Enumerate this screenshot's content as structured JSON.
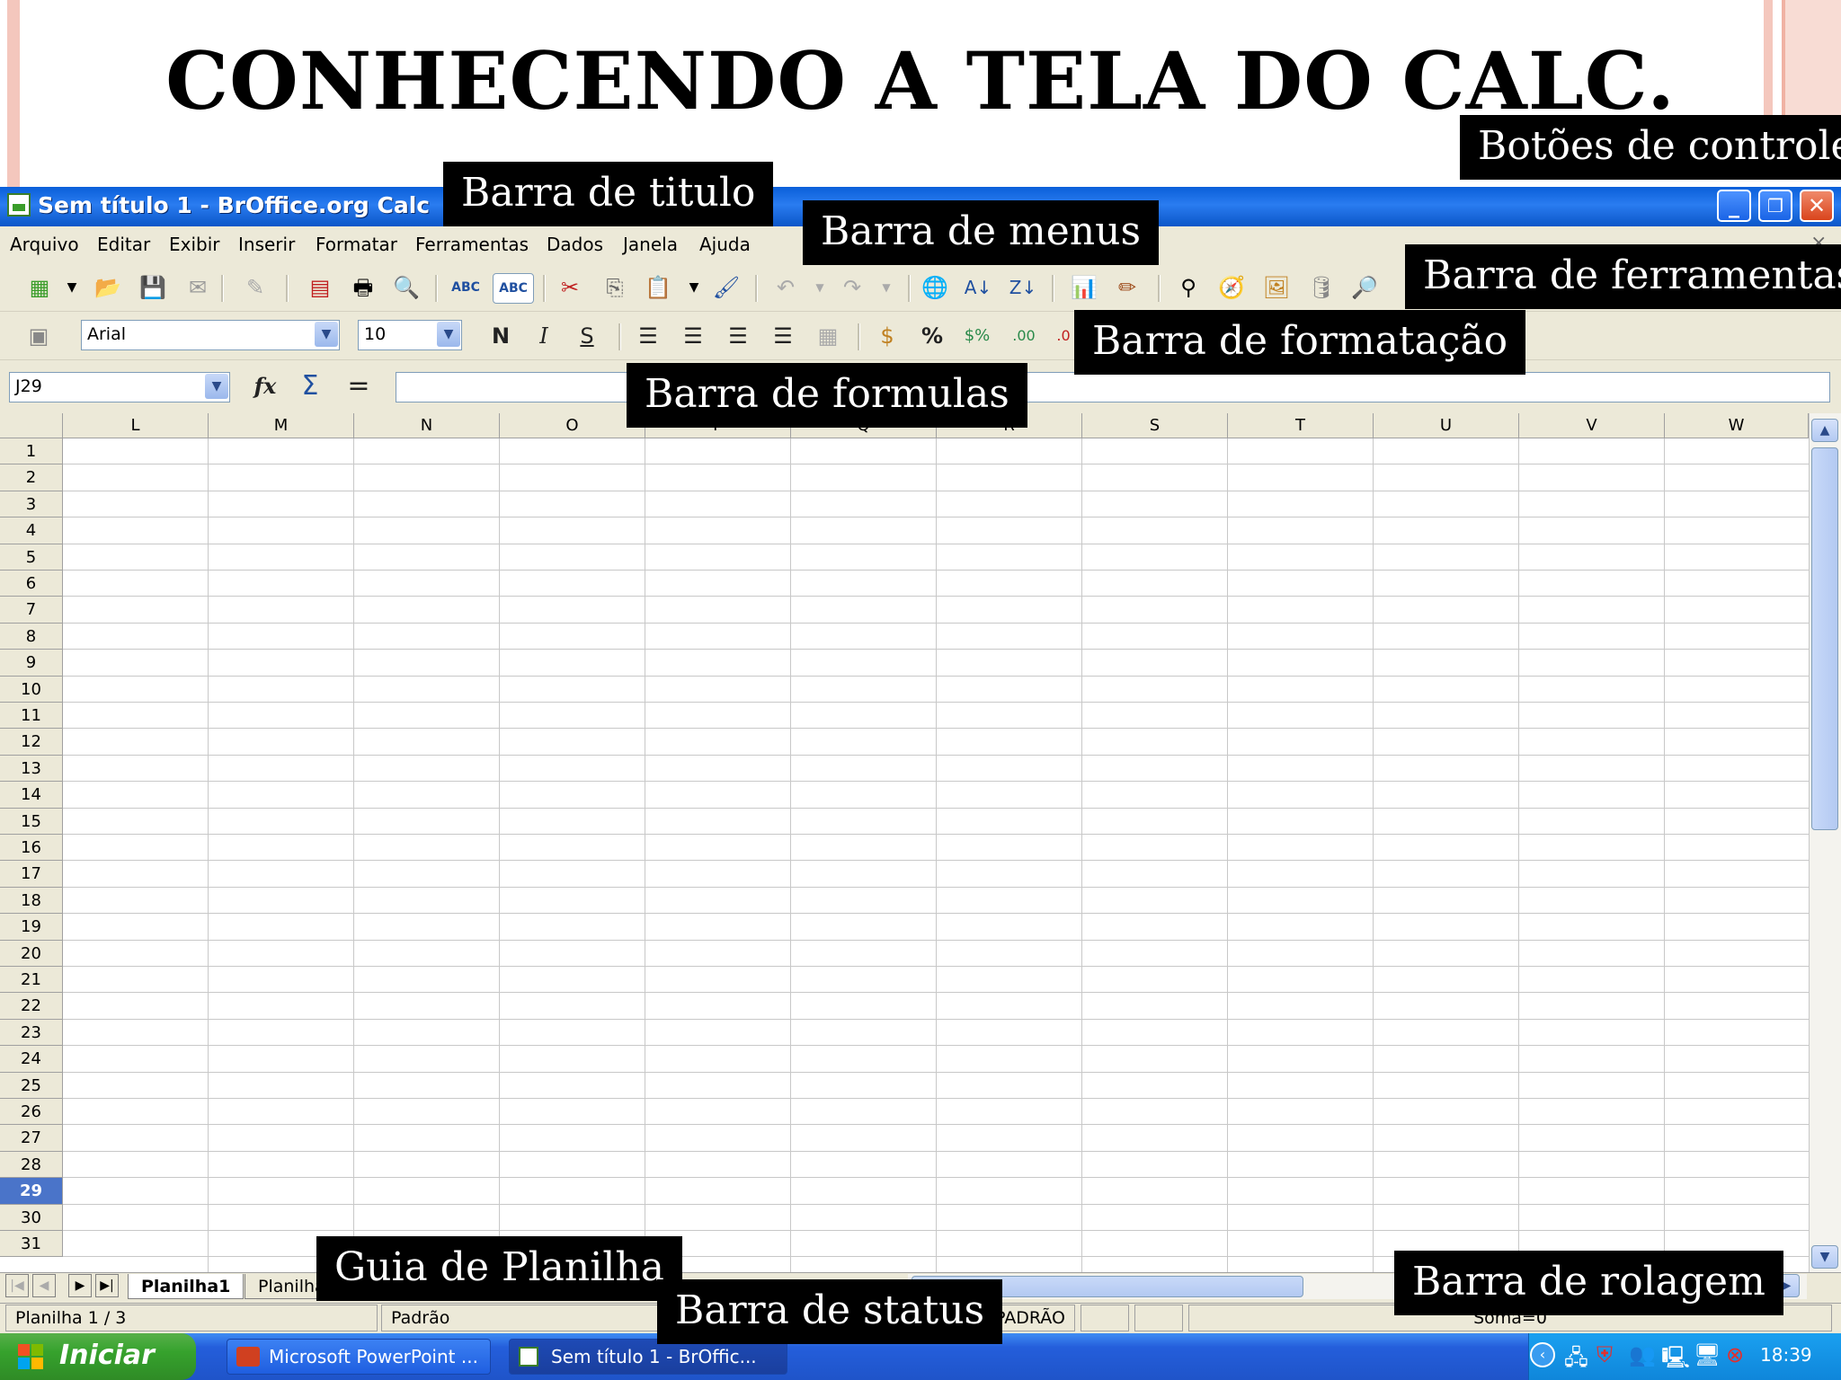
{
  "slide": {
    "title": "CONHECENDO A TELA DO CALC."
  },
  "callouts": {
    "botoes_controle": "Botões de controle",
    "barra_titulo": "Barra de titulo",
    "barra_menus": "Barra de menus",
    "barra_ferramentas": "Barra de ferramentas",
    "barra_formatacao": "Barra de formatação",
    "barra_formulas": "Barra de formulas",
    "guia_planilha": "Guia de Planilha",
    "barra_status": "Barra de status",
    "barra_rolagem": "Barra de rolagem"
  },
  "window": {
    "title": "Sem título 1 - BrOffice.org Calc"
  },
  "menu": [
    "Arquivo",
    "Editar",
    "Exibir",
    "Inserir",
    "Formatar",
    "Ferramentas",
    "Dados",
    "Janela",
    "Ajuda"
  ],
  "format": {
    "font": "Arial",
    "size": "10",
    "bold": "N",
    "italic": "I",
    "shadow": "S",
    "percent": "%"
  },
  "formula": {
    "cell_ref": "J29",
    "fx": "fx",
    "sum": "Σ",
    "equals": "="
  },
  "columns": [
    "L",
    "M",
    "N",
    "O",
    "P",
    "Q",
    "R",
    "S",
    "T",
    "U",
    "V",
    "W"
  ],
  "rows": [
    "1",
    "2",
    "3",
    "4",
    "5",
    "6",
    "7",
    "8",
    "9",
    "10",
    "11",
    "12",
    "13",
    "14",
    "15",
    "16",
    "17",
    "18",
    "19",
    "20",
    "21",
    "22",
    "23",
    "24",
    "25",
    "26",
    "27",
    "28",
    "29",
    "30",
    "31"
  ],
  "selected_row": "29",
  "sheets": [
    "Planilha1",
    "Planilha2"
  ],
  "status": {
    "sheet": "Planilha 1 / 3",
    "style": "Padrão",
    "mode": "PADRÃO",
    "sum": "Soma=0"
  },
  "taskbar": {
    "start": "Iniciar",
    "tasks": [
      "Microsoft PowerPoint ...",
      "Sem título 1 - BrOffic..."
    ],
    "clock": "18:39"
  }
}
